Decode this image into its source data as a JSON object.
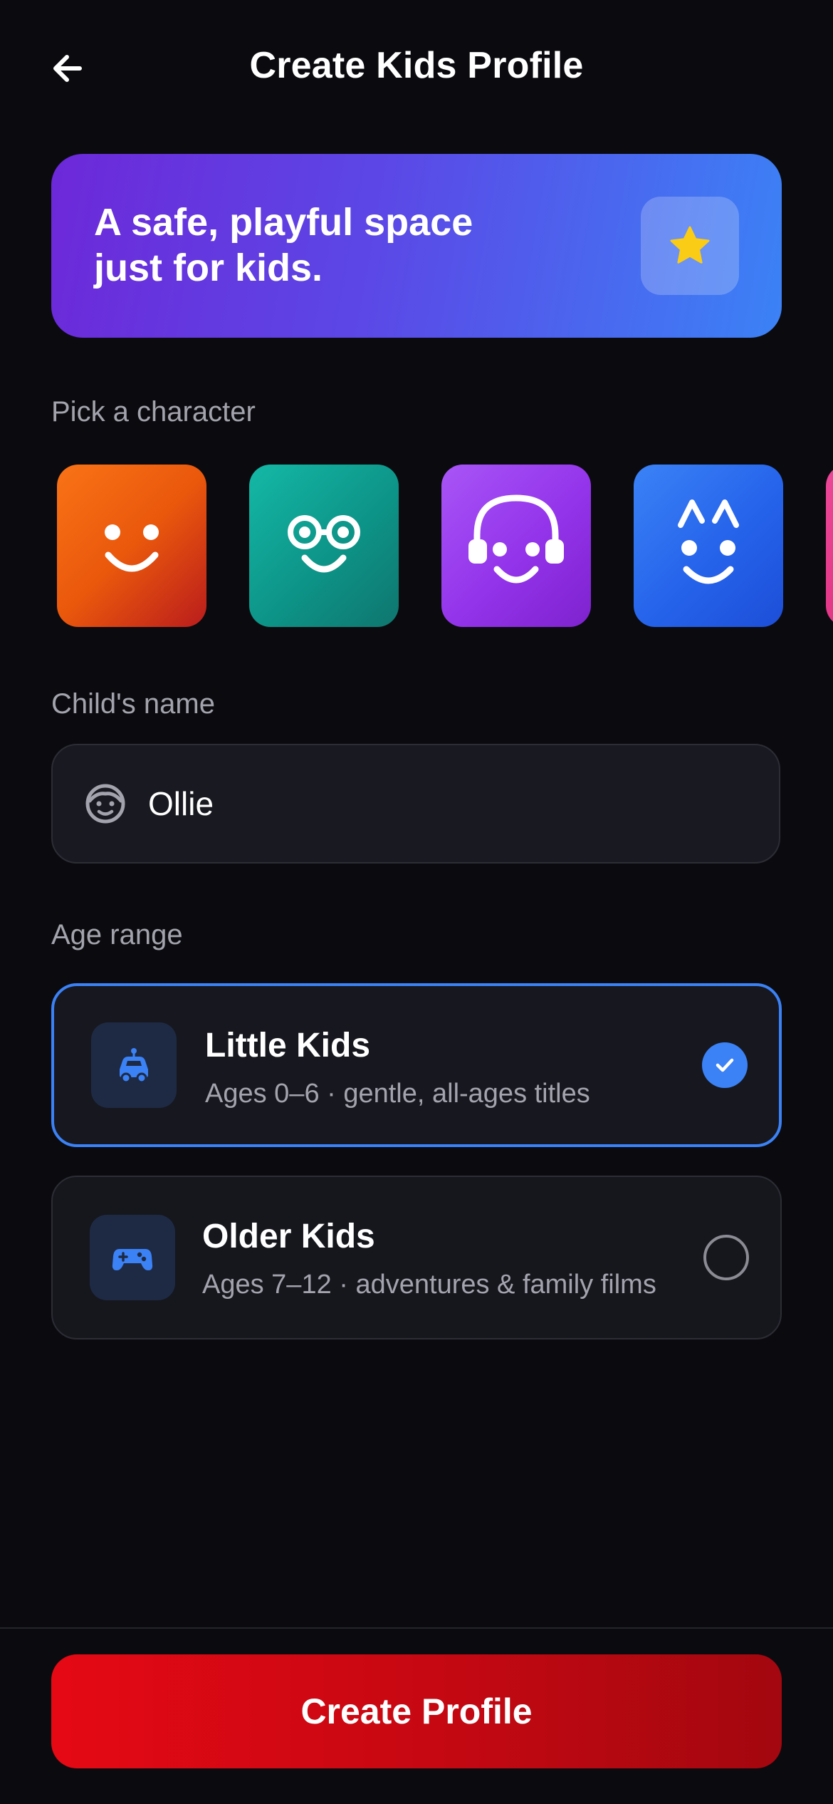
{
  "header": {
    "title": "Create Kids Profile",
    "back_icon": "arrow-left-icon"
  },
  "banner": {
    "text": "A safe, playful space just for kids.",
    "badge_icon": "star-icon"
  },
  "character_section": {
    "label": "Pick a character",
    "characters": [
      {
        "name": "smile-face",
        "color": "#ea580c"
      },
      {
        "name": "glasses-face",
        "color": "#0d9488"
      },
      {
        "name": "headphones-face",
        "color": "#9333ea"
      },
      {
        "name": "antenna-face",
        "color": "#2563eb"
      },
      {
        "name": "pink-face",
        "color": "#db2777"
      }
    ]
  },
  "name_section": {
    "label": "Child's name",
    "value": "Ollie",
    "icon": "child-face-icon"
  },
  "age_section": {
    "label": "Age range",
    "options": [
      {
        "title": "Little Kids",
        "subtitle": "Ages 0–6 · gentle, all-ages titles",
        "icon": "car-icon",
        "selected": true
      },
      {
        "title": "Older Kids",
        "subtitle": "Ages 7–12 · adventures & family films",
        "icon": "gamepad-icon",
        "selected": false
      }
    ]
  },
  "footer": {
    "cta_label": "Create Profile"
  },
  "colors": {
    "background": "#0b0b0f",
    "accent_blue": "#3b82f6",
    "cta_red": "#e50914",
    "star_yellow": "#facc15"
  }
}
